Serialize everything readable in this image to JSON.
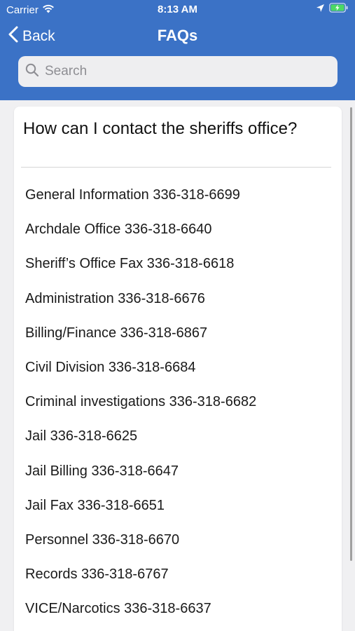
{
  "status_bar": {
    "carrier": "Carrier",
    "time": "8:13 AM"
  },
  "nav": {
    "back_label": "Back",
    "title": "FAQs"
  },
  "search": {
    "placeholder": "Search"
  },
  "faq": {
    "question": "How can I contact the sheriffs office?",
    "contacts": [
      "General Information 336-318-6699",
      "Archdale Office 336-318-6640",
      "Sheriff’s Office Fax 336-318-6618",
      "Administration 336-318-6676",
      "Billing/Finance 336-318-6867",
      "Civil Division 336-318-6684",
      "Criminal investigations 336-318-6682",
      "Jail 336-318-6625",
      "Jail Billing 336-318-6647",
      "Jail Fax 336-318-6651",
      "Personnel 336-318-6670",
      "Records 336-318-6767",
      "VICE/Narcotics 336-318-6637"
    ]
  },
  "colors": {
    "header": "#3b72c6",
    "background": "#f0f0f2",
    "card": "#ffffff",
    "battery": "#4cd964"
  },
  "icons": {
    "wifi": "wifi-icon",
    "location": "location-arrow-icon",
    "battery": "battery-charging-icon",
    "back": "chevron-left-icon",
    "search": "search-icon"
  }
}
